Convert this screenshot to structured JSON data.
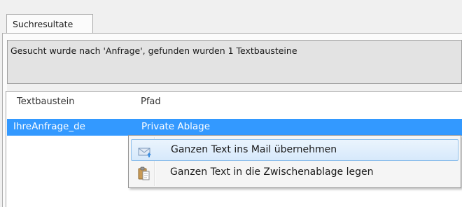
{
  "tabs": [
    {
      "label": "Suchresultate",
      "selected": true
    }
  ],
  "message": "Gesucht wurde nach 'Anfrage', gefunden wurden 1 Textbausteine",
  "table": {
    "columns": [
      "Textbaustein",
      "Pfad"
    ],
    "rows": [
      {
        "textbaustein": "IhreAnfrage_de",
        "pfad": "Private Ablage",
        "selected": true
      }
    ]
  },
  "context_menu": {
    "items": [
      {
        "label": "Ganzen Text ins Mail übernehmen",
        "icon": "mail-transfer-icon",
        "highlighted": true
      },
      {
        "label": "Ganzen Text in die Zwischenablage legen",
        "icon": "clipboard-icon",
        "highlighted": false
      }
    ]
  },
  "colors": {
    "selection": "#3399ff",
    "menu_highlight_border": "#8fc0ec",
    "message_background": "#e3e3e3"
  }
}
